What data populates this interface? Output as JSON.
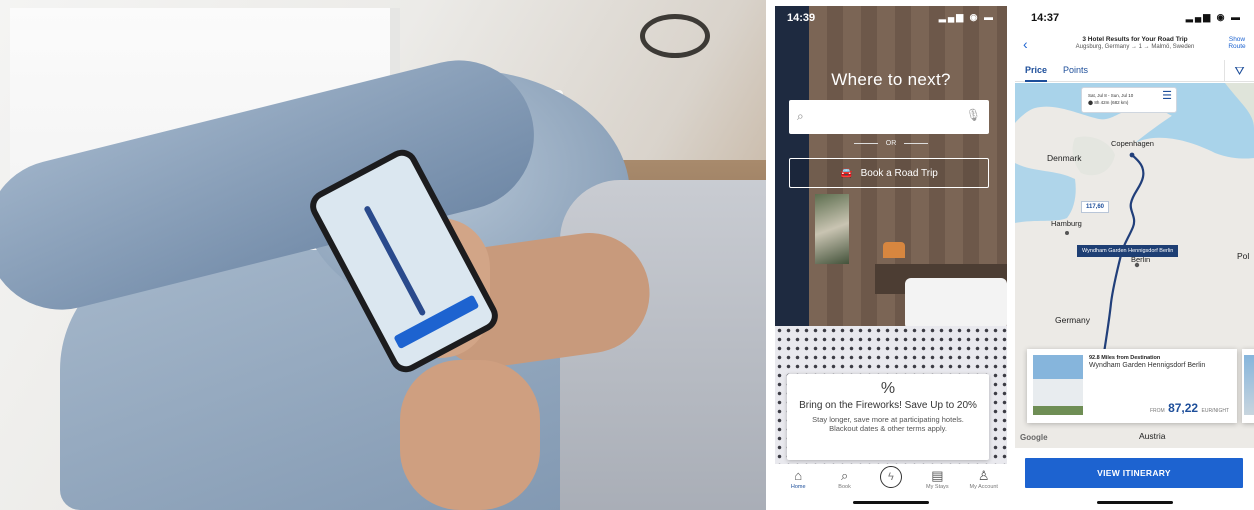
{
  "home": {
    "status_time": "14:39",
    "status_icons": "▂▄▆ ◉ ▬",
    "title": "Where to next?",
    "search": {
      "placeholder": ""
    },
    "or_label": "OR",
    "road_trip_button": "Book a Road Trip",
    "promo": {
      "icon": "%",
      "headline": "Bring on the Fireworks! Save Up to 20%",
      "subtext": "Stay longer, save more at participating hotels. Blackout dates & other terms apply."
    },
    "tabs": [
      {
        "label": "Home",
        "icon": "home-icon"
      },
      {
        "label": "Book",
        "icon": "search-icon"
      },
      {
        "label": "",
        "icon": "lightning-icon"
      },
      {
        "label": "My Stays",
        "icon": "suitcase-icon"
      },
      {
        "label": "My Account",
        "icon": "person-icon"
      }
    ]
  },
  "trip": {
    "status_time": "14:37",
    "status_icons": "▂▄▆ ◉ ▬",
    "header_title": "3 Hotel Results for Your Road Trip",
    "header_route": "Augsburg, Germany → 1 → Malmö, Sweden",
    "show_route": "Show Route",
    "tab_price": "Price",
    "tab_points": "Points",
    "map_chip_dates": "Sat, Jul 8 - Sun, Jul 10",
    "map_chip_distance": "8h 42m (682 km)",
    "map_labels": {
      "denmark": "Denmark",
      "copenhagen": "Copenhagen",
      "hamburg": "Hamburg",
      "berlin": "Berlin",
      "germany": "Germany",
      "austria": "Austria",
      "pol": "Pol"
    },
    "price_pin": "117,60",
    "hotel_pin": "Wyndham Garden Hennigsdorf Berlin",
    "card": {
      "distance": "92.8 Miles from Destination",
      "name": "Wyndham Garden Hennigsdorf Berlin",
      "from_label": "FROM",
      "price": "87,22",
      "per_night": "EUR/NIGHT"
    },
    "google_label": "Google",
    "cta": "VIEW ITINERARY"
  }
}
